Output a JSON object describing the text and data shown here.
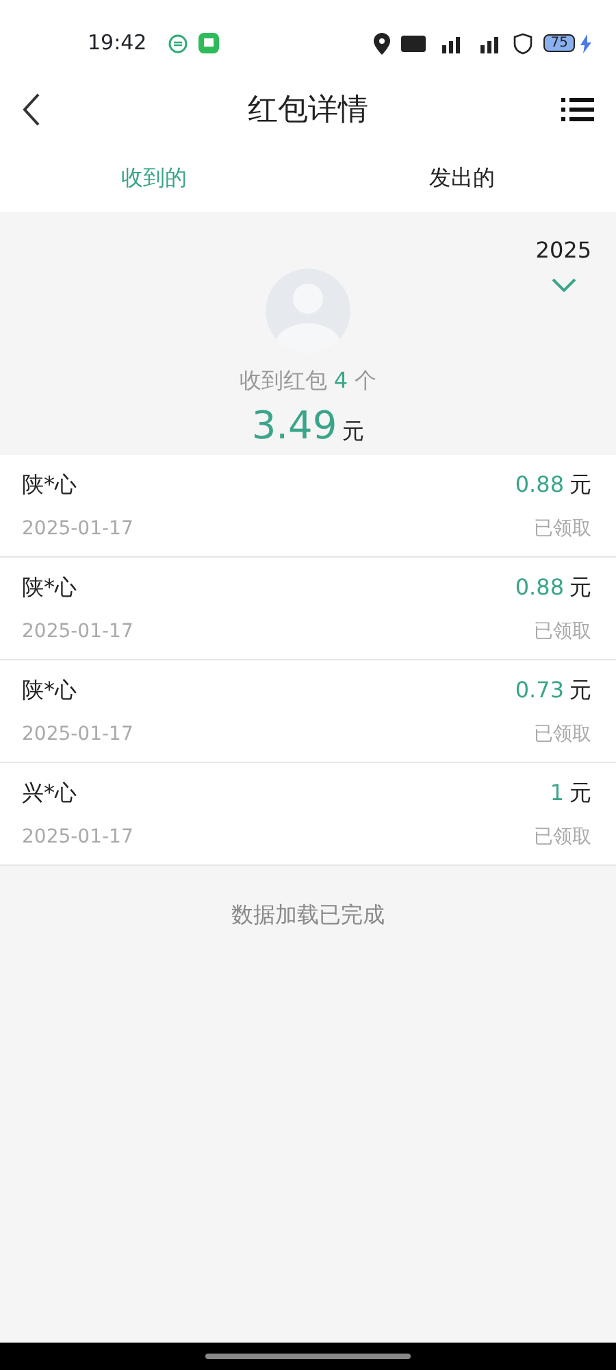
{
  "status_bar": {
    "time": "19:42",
    "battery": "75"
  },
  "header": {
    "title": "红包详情"
  },
  "tabs": [
    {
      "label": "收到的",
      "selected": true
    },
    {
      "label": "发出的",
      "selected": false
    }
  ],
  "summary": {
    "year": "2025",
    "count_prefix": "收到红包",
    "count": "4",
    "count_unit": "个",
    "total": "3.49",
    "total_unit": "元"
  },
  "records": [
    {
      "name": "陕*心",
      "date": "2025-01-17",
      "amount": "0.88",
      "unit": "元",
      "status": "已领取"
    },
    {
      "name": "陕*心",
      "date": "2025-01-17",
      "amount": "0.88",
      "unit": "元",
      "status": "已领取"
    },
    {
      "name": "陕*心",
      "date": "2025-01-17",
      "amount": "0.73",
      "unit": "元",
      "status": "已领取"
    },
    {
      "name": "兴*心",
      "date": "2025-01-17",
      "amount": "1",
      "unit": "元",
      "status": "已领取"
    }
  ],
  "footer": "数据加载已完成"
}
